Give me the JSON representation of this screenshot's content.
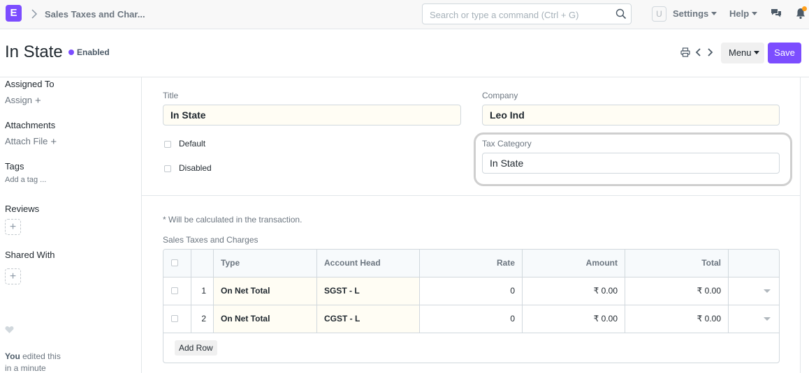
{
  "navbar": {
    "logo_letter": "E",
    "breadcrumb": "Sales Taxes and Char...",
    "search_placeholder": "Search or type a command (Ctrl + G)",
    "avatar_initial": "U",
    "settings_label": "Settings",
    "help_label": "Help"
  },
  "page": {
    "title": "In State",
    "status": "Enabled",
    "menu_label": "Menu",
    "save_label": "Save"
  },
  "sidebar": {
    "assigned_to": "Assigned To",
    "assign": "Assign",
    "attachments": "Attachments",
    "attach_file": "Attach File",
    "tags": "Tags",
    "add_tag": "Add a tag ...",
    "reviews": "Reviews",
    "shared_with": "Shared With",
    "activity_user": "You",
    "activity_text": " edited this",
    "activity_time": "in a minute"
  },
  "form": {
    "title_label": "Title",
    "title_value": "In State",
    "company_label": "Company",
    "company_value": "Leo Ind",
    "default_label": "Default",
    "disabled_label": "Disabled",
    "tax_category_label": "Tax Category",
    "tax_category_value": "In State",
    "note": "* Will be calculated in the transaction.",
    "grid_label": "Sales Taxes and Charges",
    "add_row": "Add Row"
  },
  "grid": {
    "headers": {
      "type": "Type",
      "account_head": "Account Head",
      "rate": "Rate",
      "amount": "Amount",
      "total": "Total"
    },
    "rows": [
      {
        "idx": "1",
        "type": "On Net Total",
        "account_head": "SGST - L",
        "rate": "0",
        "amount": "₹ 0.00",
        "total": "₹ 0.00"
      },
      {
        "idx": "2",
        "type": "On Net Total",
        "account_head": "CGST - L",
        "rate": "0",
        "amount": "₹ 0.00",
        "total": "₹ 0.00"
      }
    ]
  },
  "colors": {
    "accent": "#7c4dff",
    "notification": "#ff9f1a",
    "field_filled": "#fffdf4"
  }
}
